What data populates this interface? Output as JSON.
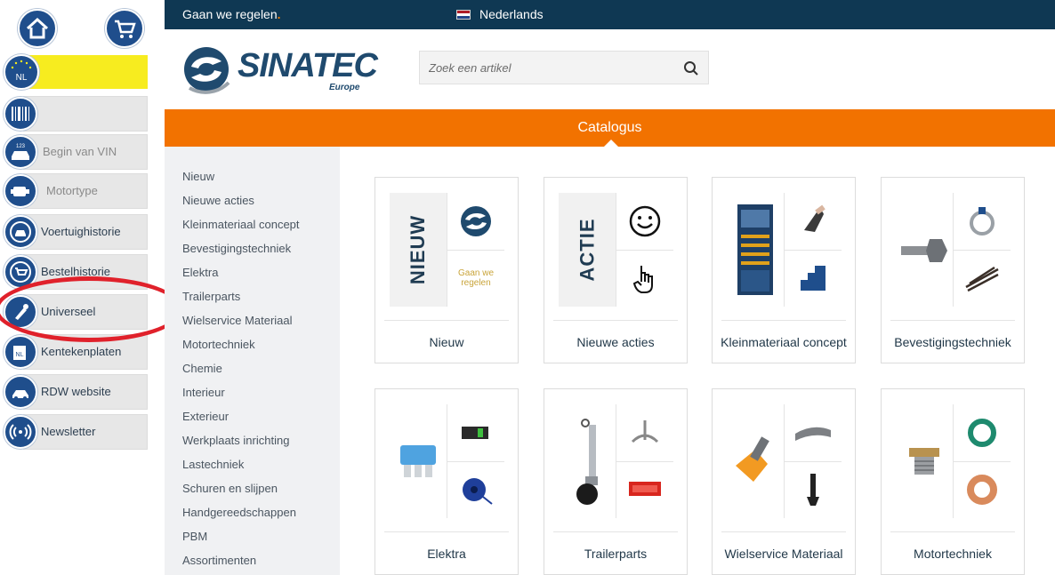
{
  "toolbar": {
    "region": "NL",
    "vin_label": "Begin van VIN",
    "motortype_label": "Motortype",
    "items": [
      {
        "label": "Voertuighistorie",
        "icon": "car-history-icon"
      },
      {
        "label": "Bestelhistorie",
        "icon": "order-history-icon"
      },
      {
        "label": "Universeel",
        "icon": "universal-icon"
      },
      {
        "label": "Kentekenplaten",
        "icon": "license-plate-icon"
      },
      {
        "label": "RDW website",
        "icon": "rdw-icon"
      },
      {
        "label": "Newsletter",
        "icon": "newsletter-icon"
      }
    ]
  },
  "topbar": {
    "tagline": "Gaan we regelen",
    "tagline_dot": ".",
    "language": "Nederlands"
  },
  "header": {
    "logo_text": "SINATEC",
    "logo_sub": "Europe",
    "search_placeholder": "Zoek een artikel"
  },
  "nav": {
    "catalog": "Catalogus"
  },
  "categories": [
    "Nieuw",
    "Nieuwe acties",
    "Kleinmateriaal concept",
    "Bevestigingstechniek",
    "Elektra",
    "Trailerparts",
    "Wielservice Materiaal",
    "Motortechniek",
    "Chemie",
    "Interieur",
    "Exterieur",
    "Werkplaats inrichting",
    "Lastechniek",
    "Schuren en slijpen",
    "Handgereedschappen",
    "PBM",
    "Assortimenten"
  ],
  "cards": [
    {
      "title": "Nieuw",
      "vertical": "NIEUW",
      "aside_text": "Gaan we regelen"
    },
    {
      "title": "Nieuwe acties",
      "vertical": "ACTIE"
    },
    {
      "title": "Kleinmateriaal concept"
    },
    {
      "title": "Bevestigingstechniek"
    },
    {
      "title": "Elektra"
    },
    {
      "title": "Trailerparts"
    },
    {
      "title": "Wielservice Materiaal"
    },
    {
      "title": "Motortechniek"
    }
  ],
  "colors": {
    "topbar": "#0f3853",
    "accent": "#f27200",
    "highlight": "#f7ec1f",
    "annotation": "#e0212b"
  }
}
